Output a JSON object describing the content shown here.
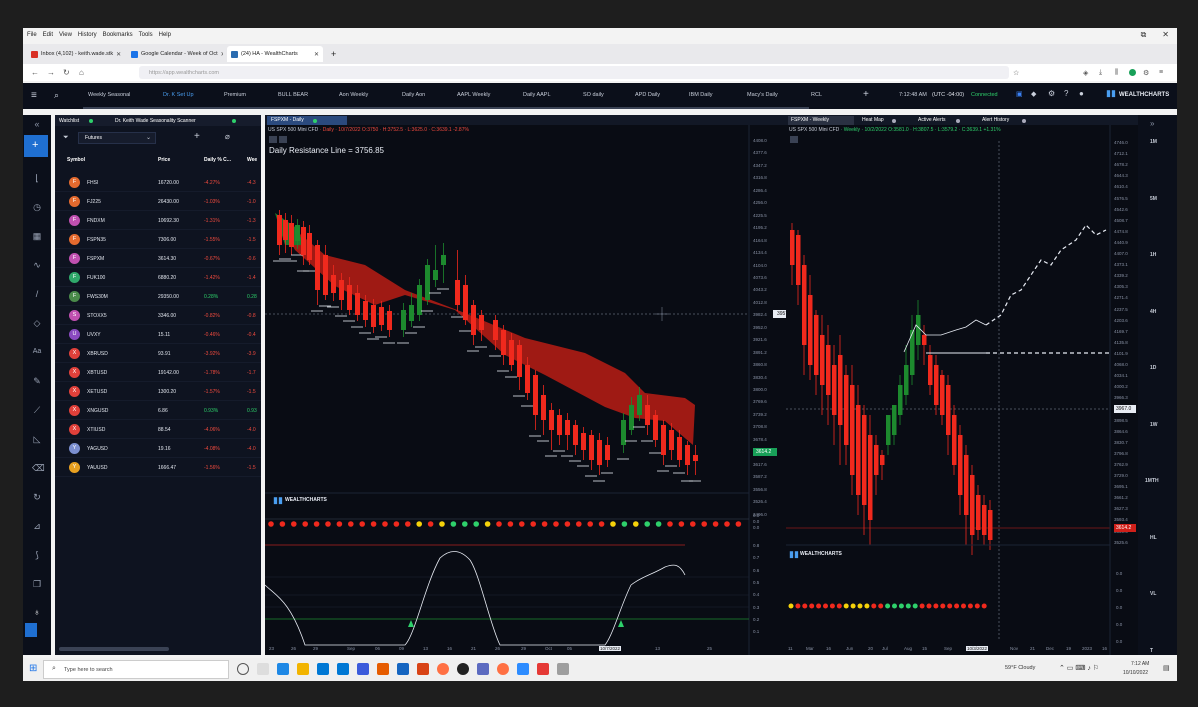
{
  "browser": {
    "menu": [
      "File",
      "Edit",
      "View",
      "History",
      "Bookmarks",
      "Tools",
      "Help"
    ],
    "tabs": [
      {
        "label": "Inbox (4,102) - keith.wade.stk",
        "color": "#d93025",
        "active": false
      },
      {
        "label": "Google Calendar - Week of Oct",
        "color": "#1a73e8",
        "active": false
      },
      {
        "label": "(24) HA - WealthCharts",
        "color": "#2b6cb0",
        "active": true
      }
    ],
    "url": "https://app.wealthcharts.com"
  },
  "app": {
    "workspace_tabs": [
      "Weekly Seasonal",
      "Dr. K Set Up",
      "Premium",
      "BULL BEAR",
      "Aon Weekly",
      "Daily Aon",
      "AAPL Weekly",
      "Daily AAPL",
      "SO daily",
      "APD Daily",
      "IBM Daily",
      "Macy's Daily",
      "RCL"
    ],
    "active_workspace": "Dr. K Set Up",
    "clock": "7:12:48 AM",
    "timezone": "(UTC -04:00)",
    "connection": "Connected",
    "brand": "WEALTHCHARTS",
    "timeframes": [
      "1M",
      "5M",
      "1H",
      "4H",
      "1D",
      "1W",
      "1MTH",
      "HL",
      "VL",
      "T"
    ]
  },
  "watchlist": {
    "tab1": "Watchlist",
    "tab2": "Dr. Keith Wade Seasonality Scanner",
    "filter": "Futures",
    "headers": [
      "Symbol",
      "Price",
      "Daily % C...",
      "Wee"
    ],
    "rows": [
      {
        "letter": "F",
        "color": "#e46a2e",
        "symbol": "FHSI",
        "price": "16720.00",
        "daily": "-4.27%",
        "weekly": "-4.3",
        "dir": "neg"
      },
      {
        "letter": "F",
        "color": "#e46a2e",
        "symbol": "FJ225",
        "price": "26430.00",
        "daily": "-1.03%",
        "weekly": "-1.0",
        "dir": "neg"
      },
      {
        "letter": "F",
        "color": "#c050b0",
        "symbol": "FNDXM",
        "price": "10692.30",
        "daily": "-1.31%",
        "weekly": "-1.3",
        "dir": "neg"
      },
      {
        "letter": "F",
        "color": "#e46a2e",
        "symbol": "FSPN35",
        "price": "7306.00",
        "daily": "-1.55%",
        "weekly": "-1.5",
        "dir": "neg"
      },
      {
        "letter": "F",
        "color": "#c050b0",
        "symbol": "FSPXM",
        "price": "3614.30",
        "daily": "-0.67%",
        "weekly": "-0.6",
        "dir": "neg"
      },
      {
        "letter": "F",
        "color": "#2fa86a",
        "symbol": "FUK100",
        "price": "6880.20",
        "daily": "-1.42%",
        "weekly": "-1.4",
        "dir": "neg"
      },
      {
        "letter": "F",
        "color": "#4a8a4a",
        "symbol": "FWS30M",
        "price": "29350.00",
        "daily": "0.28%",
        "weekly": "0.28",
        "dir": "pos"
      },
      {
        "letter": "S",
        "color": "#c050b0",
        "symbol": "STOXX5",
        "price": "3346.00",
        "daily": "-0.82%",
        "weekly": "-0.8",
        "dir": "neg"
      },
      {
        "letter": "U",
        "color": "#8a4ac0",
        "symbol": "UVXY",
        "price": "15.11",
        "daily": "-0.46%",
        "weekly": "-0.4",
        "dir": "neg"
      },
      {
        "letter": "X",
        "color": "#e0403a",
        "symbol": "XBRUSD",
        "price": "93.91",
        "daily": "-3.92%",
        "weekly": "-3.9",
        "dir": "neg"
      },
      {
        "letter": "X",
        "color": "#e0403a",
        "symbol": "XBTUSD",
        "price": "19142.00",
        "daily": "-1.78%",
        "weekly": "-1.7",
        "dir": "neg"
      },
      {
        "letter": "X",
        "color": "#e0403a",
        "symbol": "XETUSD",
        "price": "1300.20",
        "daily": "-1.57%",
        "weekly": "-1.5",
        "dir": "neg"
      },
      {
        "letter": "X",
        "color": "#e0403a",
        "symbol": "XNGUSD",
        "price": "6.86",
        "daily": "0.93%",
        "weekly": "0.93",
        "dir": "pos"
      },
      {
        "letter": "X",
        "color": "#e0403a",
        "symbol": "XTIUSD",
        "price": "88.54",
        "daily": "-4.06%",
        "weekly": "-4.0",
        "dir": "neg"
      },
      {
        "letter": "Y",
        "color": "#7b8fd0",
        "symbol": "YAGUSD",
        "price": "19.16",
        "daily": "-4.08%",
        "weekly": "-4.0",
        "dir": "neg"
      },
      {
        "letter": "Y",
        "color": "#e8a020",
        "symbol": "YAUUSD",
        "price": "1666.47",
        "daily": "-1.56%",
        "weekly": "-1.5",
        "dir": "neg"
      }
    ]
  },
  "daily_chart": {
    "tab": "FSPXM - Daily",
    "title": "US SPX 500 Mini CFD",
    "info": "· Daily · 10/7/2022  O:3750 · H:3752.5 · L:3625.0 · C:3639.1  -2.87%",
    "annotation": "Daily Resistance Line = 3756.85",
    "price_labels": [
      "4408.0",
      "4377.6",
      "4347.2",
      "4316.8",
      "4286.4",
      "4256.0",
      "4225.5",
      "4195.2",
      "4164.8",
      "4134.4",
      "4104.0",
      "4073.6",
      "4043.2",
      "4012.8",
      "3982.4",
      "3952.0",
      "3921.6",
      "3891.2",
      "3860.8",
      "3830.4",
      "3800.0",
      "3769.6",
      "3739.2",
      "3708.8",
      "3678.4",
      "3648.0",
      "3617.6",
      "3587.2",
      "3556.8",
      "3526.4",
      "3496.0"
    ],
    "crosshair_price": "3957.0",
    "last_price": "3614.2",
    "date_labels": [
      "23",
      "26",
      "29",
      "Sep",
      "06",
      "09",
      "13",
      "16",
      "21",
      "26",
      "29",
      "Oct",
      "05",
      "10/7/2022",
      "13",
      "25"
    ],
    "indicator_brand": "WEALTHCHARTS",
    "dots": [
      "r",
      "r",
      "r",
      "r",
      "r",
      "r",
      "r",
      "r",
      "r",
      "r",
      "r",
      "r",
      "r",
      "y",
      "r",
      "y",
      "g",
      "g",
      "g",
      "y",
      "r",
      "r",
      "r",
      "r",
      "r",
      "r",
      "r",
      "r",
      "r",
      "r",
      "y",
      "g",
      "y",
      "g",
      "g",
      "r",
      "r",
      "r",
      "r",
      "r",
      "r",
      "r"
    ],
    "dot_scale": [
      "0.0",
      "0.0",
      "0.0"
    ],
    "osc_scale": [
      "0.8",
      "0.7",
      "0.6",
      "0.5",
      "0.4",
      "0.3",
      "0.2",
      "0.1"
    ]
  },
  "weekly_chart": {
    "tab": "FSPXM - Weekly",
    "tabs": [
      "Heat Map",
      "Active Alerts",
      "Alert History"
    ],
    "title": "US SPX 500 Mini CFD",
    "info": "· Weekly · 10/2/2022  O:3581.0 · H:3807.5 · L:3579.2 · C:3639.1  +1.31%",
    "price_labels": [
      "4746.0",
      "4712.1",
      "4678.2",
      "4644.3",
      "4610.4",
      "4576.5",
      "4542.6",
      "4508.7",
      "4474.8",
      "4440.9",
      "4407.0",
      "4373.1",
      "4339.2",
      "4305.3",
      "4271.4",
      "4237.5",
      "4203.6",
      "4169.7",
      "4135.8",
      "4101.9",
      "4068.0",
      "4034.1",
      "4000.2",
      "3966.3",
      "3932.4",
      "3898.5",
      "3864.6",
      "3830.7",
      "3796.8",
      "3762.9",
      "3729.0",
      "3695.1",
      "3661.2",
      "3627.3",
      "3593.4",
      "3559.5",
      "3525.6"
    ],
    "crosshair_price": "3967.0",
    "last_price": "3614.2",
    "date_labels": [
      "11",
      "Mar",
      "16",
      "Jun",
      "20",
      "Jul",
      "Aug",
      "15",
      "Sep",
      "10/3/2022",
      "Nov",
      "21",
      "Dec",
      "19",
      "2023",
      "16",
      "30"
    ],
    "indicator_brand": "WEALTHCHARTS",
    "dots": [
      "y",
      "r",
      "r",
      "r",
      "r",
      "r",
      "r",
      "r",
      "y",
      "y",
      "y",
      "y",
      "r",
      "r",
      "g",
      "g",
      "g",
      "g",
      "g",
      "r",
      "r",
      "r",
      "r",
      "r",
      "r",
      "r",
      "r",
      "r",
      "r"
    ],
    "osc_scale": [
      "0.0",
      "0.0",
      "0.0",
      "0.0",
      "0.0"
    ]
  },
  "taskbar": {
    "search": "Type here to search",
    "weather": "59°F Cloudy",
    "time": "7:12 AM",
    "date": "10/10/2022"
  }
}
